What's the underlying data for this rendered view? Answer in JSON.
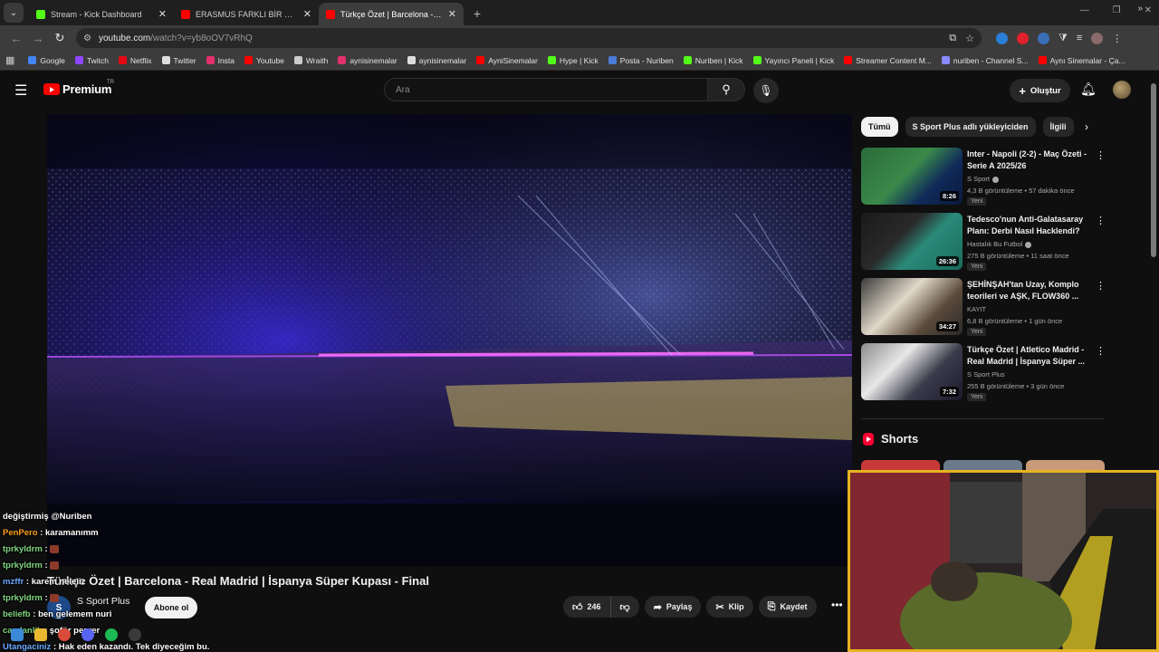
{
  "browser": {
    "tabs": [
      {
        "label": "Stream - Kick Dashboard",
        "color": "#53fc18",
        "active": false
      },
      {
        "label": "ERASMUS FARKLI BİR BEDENDE",
        "color": "#ff0000",
        "active": false
      },
      {
        "label": "Türkçe Özet | Barcelona - Real M",
        "color": "#ff0000",
        "active": true
      }
    ],
    "url_host": "youtube.com",
    "url_path": "/watch?v=yb8oOV7vRhQ",
    "bookmarks": [
      {
        "label": "Google",
        "color": "#4285f4"
      },
      {
        "label": "Twitch",
        "color": "#9146ff"
      },
      {
        "label": "Netflix",
        "color": "#e50914"
      },
      {
        "label": "Twitter",
        "color": "#dddddd"
      },
      {
        "label": "Insta",
        "color": "#e1306c"
      },
      {
        "label": "Youtube",
        "color": "#ff0000"
      },
      {
        "label": "Wraith",
        "color": "#cccccc"
      },
      {
        "label": "aynisinemalar",
        "color": "#e1306c"
      },
      {
        "label": "aynisinemalar",
        "color": "#dddddd"
      },
      {
        "label": "AyniSinemalar",
        "color": "#ff0000"
      },
      {
        "label": "Hype | Kick",
        "color": "#53fc18"
      },
      {
        "label": "Posta - Nuriben",
        "color": "#4a7bd8"
      },
      {
        "label": "Nuriben | Kick",
        "color": "#53fc18"
      },
      {
        "label": "Yayıncı Paneli | Kick",
        "color": "#53fc18"
      },
      {
        "label": "Streamer Content M...",
        "color": "#ff0000"
      },
      {
        "label": "nuriben - Channel S...",
        "color": "#8a8aff"
      },
      {
        "label": "Aynı Sinemalar - Ça...",
        "color": "#ff0000"
      }
    ]
  },
  "masthead": {
    "logo_text": "Premium",
    "country": "TR",
    "search_placeholder": "Ara",
    "create_label": "Oluştur"
  },
  "video": {
    "title": "Türkçe Özet | Barcelona - Real Madrid | İspanya Süper Kupası - Final",
    "channel": "S Sport Plus",
    "subscribe_label": "Abone ol",
    "likes": "246",
    "share_label": "Paylaş",
    "clip_label": "Klip",
    "save_label": "Kaydet"
  },
  "chips": [
    "Tümü",
    "S Sport Plus adlı yükleyiciden",
    "İlgili"
  ],
  "recommendations": [
    {
      "title": "Inter - Napoli (2-2) - Maç Özeti - Serie A 2025/26",
      "channel": "S Sport",
      "verified": true,
      "meta": "4,3 B görüntüleme • 57 dakika önce",
      "badge": "Yeni",
      "duration": "8:26"
    },
    {
      "title": "Tedesco'nun Anti-Galatasaray Planı: Derbi Nasıl Hacklendi?",
      "channel": "Hastalık Bu Futbol",
      "verified": true,
      "meta": "275 B görüntüleme • 11 saat önce",
      "badge": "Yeni",
      "duration": "26:36"
    },
    {
      "title": "ŞEHİNŞAH'tan Uzay, Komplo teorileri ve AŞK, FLOW360 ...",
      "channel": "KAYIT",
      "verified": false,
      "meta": "6,8 B görüntüleme • 1 gün önce",
      "badge": "Yeni",
      "duration": "34:27"
    },
    {
      "title": "Türkçe Özet | Atletico Madrid - Real Madrid | İspanya Süper ...",
      "channel": "S Sport Plus",
      "verified": false,
      "meta": "255 B görüntüleme • 3 gün önce",
      "badge": "Yeni",
      "duration": "7:32"
    }
  ],
  "shorts_label": "Shorts",
  "chat": [
    {
      "user": "",
      "color": "#ffffff",
      "text": "değiştirmiş @Nuriben"
    },
    {
      "user": "PenPero",
      "color": "#ff9f1c",
      "text": "karamanımm"
    },
    {
      "user": "tprkyldrm",
      "color": "#7fd67f",
      "text": ""
    },
    {
      "user": "tprkyldrm",
      "color": "#7fd67f",
      "text": ""
    },
    {
      "user": "mzffr",
      "color": "#6aa8ff",
      "text": "karem neleiiz"
    },
    {
      "user": "tprkyldrm",
      "color": "#7fd67f",
      "text": ""
    },
    {
      "user": "beliefb",
      "color": "#7fd67f",
      "text": "ben gelemem nuri"
    },
    {
      "user": "caydanlik",
      "color": "#7fd67f",
      "text": "şoför perver"
    },
    {
      "user": "Utangaciniz",
      "color": "#6aa8ff",
      "text": "Hak eden kazandı. Tek diyeceğim bu."
    }
  ]
}
